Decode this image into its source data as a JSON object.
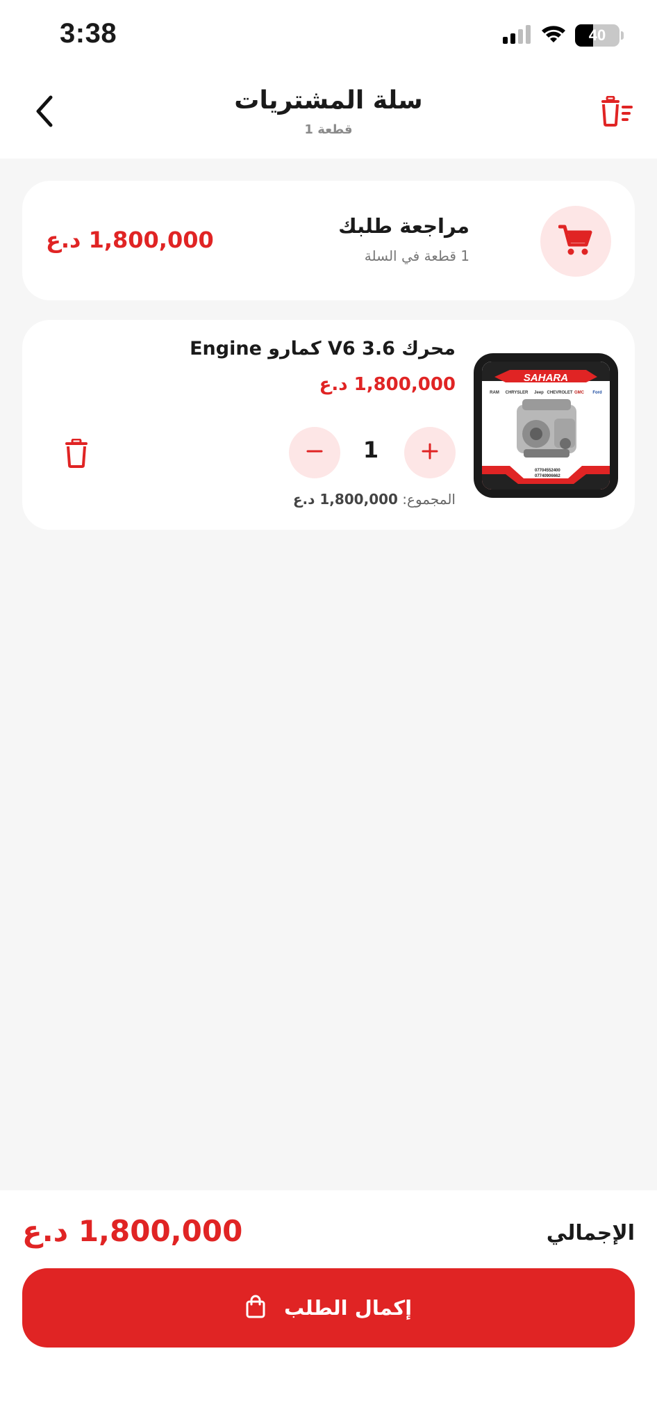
{
  "status_bar": {
    "time": "3:38",
    "battery_level": "40",
    "battery_percent": 40,
    "icons": [
      "signal-icon",
      "wifi-icon",
      "battery-icon"
    ]
  },
  "header": {
    "title": "سلة المشتريات",
    "subtitle": "1 قطعة",
    "back_icon": "chevron-left-icon",
    "clear_icon": "trash-list-icon"
  },
  "summary": {
    "title": "مراجعة طلبك",
    "count_text": "1 قطعة في السلة",
    "total": "1,800,000 د.ع",
    "icon": "cart-icon"
  },
  "cart_items": [
    {
      "name": "محرك V6 3.6 كمارو Engine",
      "price": "1,800,000 د.ع",
      "quantity": "1",
      "total_label": "المجموع:",
      "total_value": "1,800,000 د.ع",
      "image": {
        "brand": "SAHARA",
        "logos": [
          "RAM",
          "CHRYSLER",
          "Jeep",
          "CHEVROLET",
          "GMC",
          "Ford"
        ],
        "phones": [
          "07704552400",
          "07740906662"
        ]
      }
    }
  ],
  "bottom": {
    "total_label": "الإجمالي",
    "total_value": "1,800,000 د.ع",
    "checkout_label": "إكمال الطلب",
    "checkout_icon": "shopping-bag-icon"
  },
  "colors": {
    "accent": "#e02424",
    "accent_soft": "#fde6e6",
    "background": "#f6f6f6",
    "card": "#ffffff",
    "text": "#1a1a1a"
  }
}
